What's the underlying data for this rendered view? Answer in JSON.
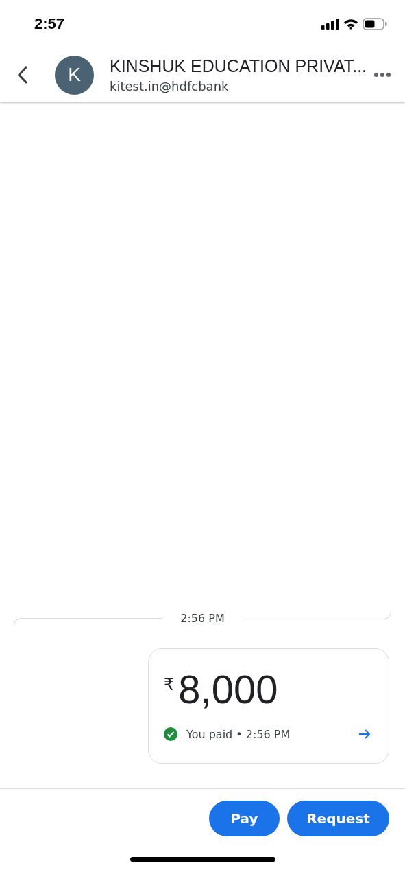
{
  "status_bar": {
    "time": "2:57"
  },
  "header": {
    "avatar_letter": "K",
    "name": "KINSHUK EDUCATION PRIVAT...",
    "upi_id": "kitest.in@hdfcbank"
  },
  "timestamp": "2:56 PM",
  "payment": {
    "currency": "₹",
    "amount": "8,000",
    "paid": true,
    "status_text": "You paid • 2:56 PM"
  },
  "buttons": [
    "Pay",
    "Request"
  ]
}
